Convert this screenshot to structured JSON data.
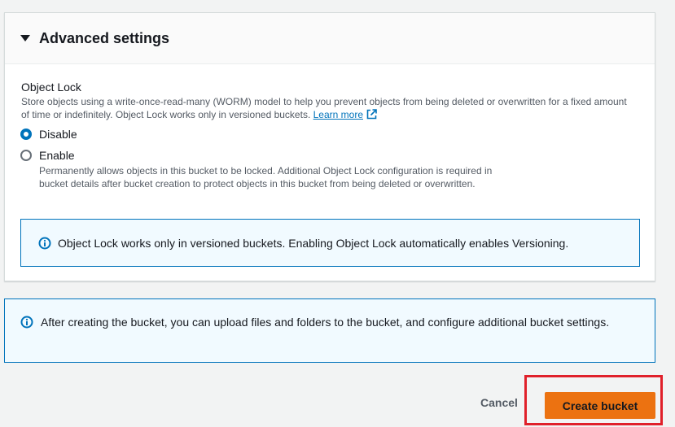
{
  "advanced_settings": {
    "title": "Advanced settings",
    "object_lock": {
      "label": "Object Lock",
      "description": "Store objects using a write-once-read-many (WORM) model to help you prevent objects from being deleted or overwritten for a fixed amount of time or indefinitely. Object Lock works only in versioned buckets.",
      "learn_more": "Learn more",
      "options": [
        {
          "label": "Disable",
          "selected": true
        },
        {
          "label": "Enable",
          "selected": false,
          "description": "Permanently allows objects in this bucket to be locked. Additional Object Lock configuration is required in bucket details after bucket creation to protect objects in this bucket from being deleted or overwritten."
        }
      ],
      "info": "Object Lock works only in versioned buckets. Enabling Object Lock automatically enables Versioning."
    }
  },
  "bottom_info": "After creating the bucket, you can upload files and folders to the bucket, and configure additional bucket settings.",
  "actions": {
    "cancel": "Cancel",
    "create": "Create bucket"
  },
  "colors": {
    "accent": "#0073bb",
    "primary_button": "#ec7211",
    "highlight": "#e0202a"
  }
}
